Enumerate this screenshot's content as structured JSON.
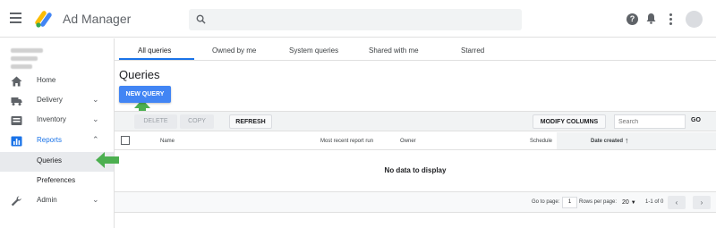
{
  "header": {
    "app_title": "Ad Manager",
    "search_placeholder": "",
    "help_glyph": "?"
  },
  "sidebar": {
    "items": [
      {
        "label": "Home",
        "icon": "home-icon"
      },
      {
        "label": "Delivery",
        "icon": "truck-icon"
      },
      {
        "label": "Inventory",
        "icon": "inventory-icon"
      },
      {
        "label": "Reports",
        "icon": "bar-chart-icon"
      },
      {
        "label": "Queries"
      },
      {
        "label": "Preferences"
      },
      {
        "label": "Admin",
        "icon": "wrench-icon"
      }
    ]
  },
  "tabs": [
    {
      "label": "All queries"
    },
    {
      "label": "Owned by me"
    },
    {
      "label": "System queries"
    },
    {
      "label": "Shared with me"
    },
    {
      "label": "Starred"
    }
  ],
  "main": {
    "title": "Queries",
    "new_query_label": "NEW QUERY"
  },
  "toolbar": {
    "delete_label": "DELETE",
    "copy_label": "COPY",
    "refresh_label": "REFRESH",
    "modify_columns_label": "MODIFY COLUMNS",
    "search_placeholder": "Search",
    "go_label": "GO"
  },
  "table": {
    "columns": [
      "Name",
      "Most recent report run",
      "Owner",
      "Schedule",
      "Date created"
    ],
    "empty_message": "No data to display"
  },
  "pagination": {
    "go_to_page_label": "Go to page:",
    "page_value": "1",
    "rows_per_page_label": "Rows per page:",
    "rows_per_page_value": "20",
    "range_label": "1-1 of 0"
  },
  "colors": {
    "accent": "#1a73e8",
    "button_blue": "#4285f4",
    "annotation_green": "#4caf50"
  }
}
